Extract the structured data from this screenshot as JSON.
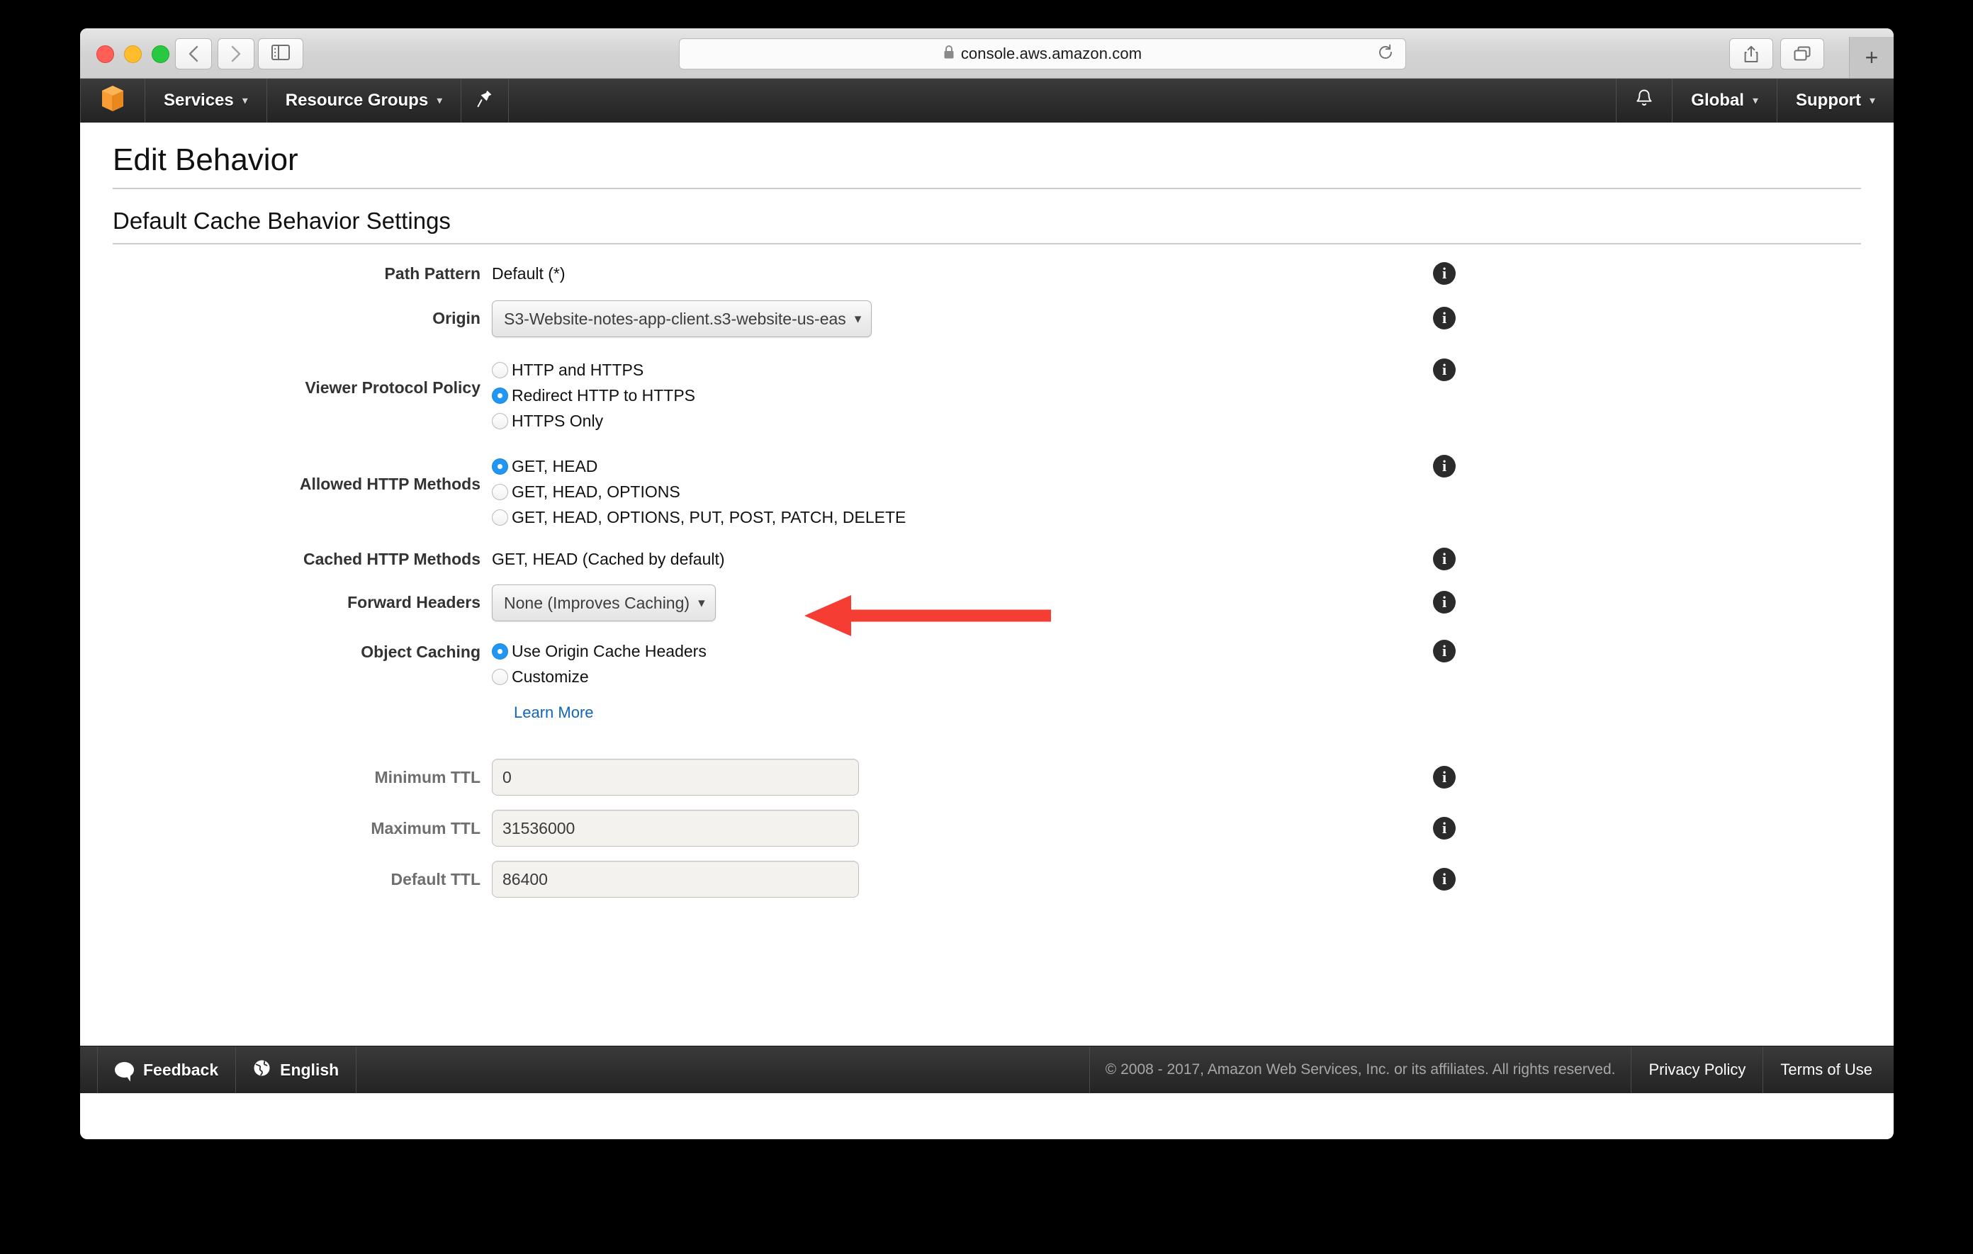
{
  "browser": {
    "url": "console.aws.amazon.com",
    "lock_icon": "lock-icon",
    "reload_icon": "reload-icon",
    "back_icon": "back-chevron-icon",
    "forward_icon": "forward-chevron-icon",
    "sidebar_icon": "sidebar-toggle-icon",
    "share_icon": "share-icon",
    "tabs_overview_icon": "tabs-overview-icon",
    "new_tab_label": "+"
  },
  "awsnav": {
    "logo_icon": "aws-cube-logo-icon",
    "services": "Services",
    "resource_groups": "Resource Groups",
    "pin_icon": "pin-icon",
    "bell_icon": "bell-icon",
    "region": "Global",
    "support": "Support",
    "caret": "▾"
  },
  "page": {
    "title": "Edit Behavior",
    "section_title": "Default Cache Behavior Settings"
  },
  "form": {
    "path_pattern": {
      "label": "Path Pattern",
      "value": "Default (*)"
    },
    "origin": {
      "label": "Origin",
      "value": "S3-Website-notes-app-client.s3-website-us-eas"
    },
    "viewer_protocol_policy": {
      "label": "Viewer Protocol Policy",
      "options": [
        {
          "label": "HTTP and HTTPS",
          "checked": false
        },
        {
          "label": "Redirect HTTP to HTTPS",
          "checked": true
        },
        {
          "label": "HTTPS Only",
          "checked": false
        }
      ]
    },
    "allowed_http_methods": {
      "label": "Allowed HTTP Methods",
      "options": [
        {
          "label": "GET, HEAD",
          "checked": true
        },
        {
          "label": "GET, HEAD, OPTIONS",
          "checked": false
        },
        {
          "label": "GET, HEAD, OPTIONS, PUT, POST, PATCH, DELETE",
          "checked": false
        }
      ]
    },
    "cached_http_methods": {
      "label": "Cached HTTP Methods",
      "value": "GET, HEAD (Cached by default)"
    },
    "forward_headers": {
      "label": "Forward Headers",
      "value": "None (Improves Caching)"
    },
    "object_caching": {
      "label": "Object Caching",
      "options": [
        {
          "label": "Use Origin Cache Headers",
          "checked": true
        },
        {
          "label": "Customize",
          "checked": false
        }
      ],
      "learn_more": "Learn More"
    },
    "minimum_ttl": {
      "label": "Minimum TTL",
      "value": "0"
    },
    "maximum_ttl": {
      "label": "Maximum TTL",
      "value": "31536000"
    },
    "default_ttl": {
      "label": "Default TTL",
      "value": "86400"
    },
    "info_glyph": "i"
  },
  "annotation": {
    "arrow_color": "#f53d33",
    "points_to": "Redirect HTTP to HTTPS"
  },
  "footer": {
    "feedback": "Feedback",
    "language": "English",
    "copyright": "© 2008 - 2017, Amazon Web Services, Inc. or its affiliates. All rights reserved.",
    "privacy_policy": "Privacy Policy",
    "terms_of_use": "Terms of Use"
  },
  "colors": {
    "accent_blue": "#2196f3",
    "link_blue": "#1166bb",
    "aws_orange": "#f89c33",
    "annotation_red": "#f53d33"
  }
}
